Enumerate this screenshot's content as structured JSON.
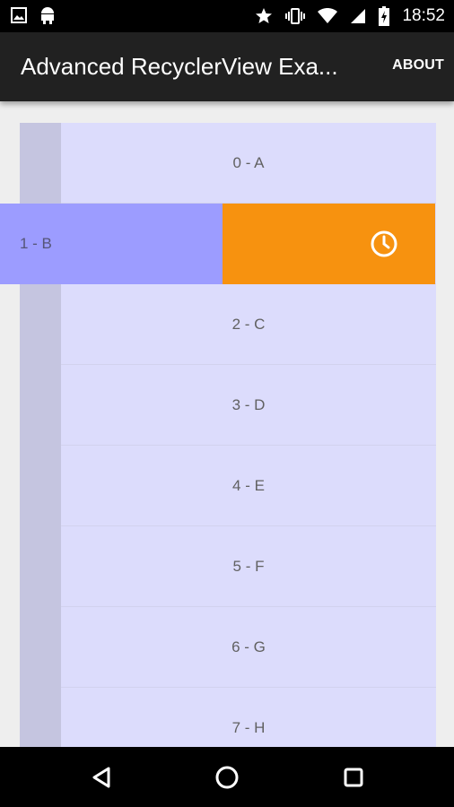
{
  "status_bar": {
    "time": "18:52",
    "left_icons": [
      "image-icon",
      "android-icon"
    ],
    "right_icons": [
      "star-icon",
      "vibrate-icon",
      "wifi-icon",
      "signal-icon",
      "battery-charging-icon"
    ]
  },
  "app_bar": {
    "title": "Advanced RecyclerView Exa...",
    "action_label": "ABOUT"
  },
  "list": {
    "items": [
      {
        "label": "0 - A"
      },
      {
        "label": "1 - B",
        "swiped": true,
        "swipe_action_icon": "clock-icon",
        "swipe_color": "#F7920F"
      },
      {
        "label": "2 - C"
      },
      {
        "label": "3 - D"
      },
      {
        "label": "4 - E"
      },
      {
        "label": "5 - F"
      },
      {
        "label": "6 - G"
      },
      {
        "label": "7 - H"
      }
    ]
  },
  "nav_bar": {
    "buttons": [
      "back-icon",
      "home-icon",
      "recents-icon"
    ]
  },
  "colors": {
    "app_bar": "#212121",
    "item_bg": "#DCDCFC",
    "item_handle": "#C5C5E0",
    "swiped_item": "#9C9CFF",
    "swipe_background": "#F7920F"
  }
}
